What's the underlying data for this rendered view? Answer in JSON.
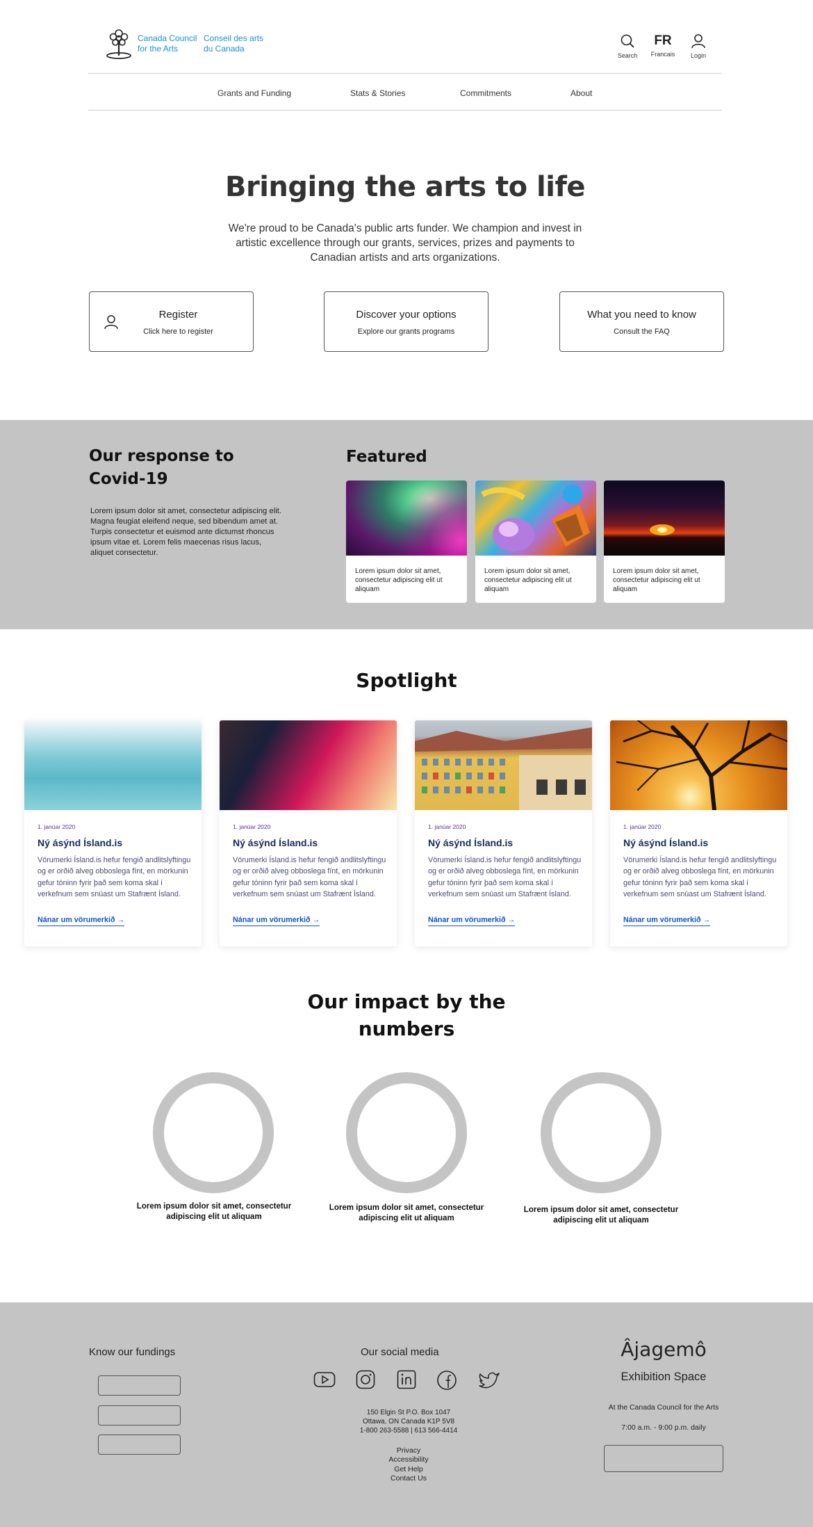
{
  "header": {
    "brand_en": "Canada Council\nfor the Arts",
    "brand_fr": "Conseil des arts\ndu Canada",
    "search_label": "Search",
    "lang_code": "FR",
    "lang_label": "Francais",
    "login_label": "Login"
  },
  "nav": {
    "items": [
      {
        "label": "Grants and Funding"
      },
      {
        "label": "Stats & Stories"
      },
      {
        "label": "Commitments"
      },
      {
        "label": "About"
      }
    ]
  },
  "hero": {
    "title": "Bringing the arts to life",
    "text": "We're proud to be Canada's public arts funder. We champion and invest in artistic excellence through our grants, services, prizes and payments to Canadian artists and arts organizations.",
    "ctas": [
      {
        "title": "Register",
        "subtitle": "Click here to register",
        "icon": "user-icon"
      },
      {
        "title": "Discover your options",
        "subtitle": "Explore our grants programs"
      },
      {
        "title": "What you need to know",
        "subtitle": "Consult the FAQ"
      }
    ]
  },
  "covid": {
    "title": "Our response to Covid-19",
    "text": "Lorem ipsum dolor sit amet, consectetur adipiscing elit. Magna feugiat eleifend neque, sed bibendum amet at. Turpis consectetur et euismod ante dictumst rhoncus ipsum vitae et. Lorem felis maecenas risus lacus, aliquet consectetur."
  },
  "featured": {
    "title": "Featured",
    "cards": [
      {
        "text": "Lorem ipsum dolor sit amet, consectetur adipiscing elit ut aliquam"
      },
      {
        "text": "Lorem ipsum dolor sit amet, consectetur adipiscing elit ut aliquam"
      },
      {
        "text": "Lorem ipsum dolor sit amet, consectetur adipiscing elit ut aliquam"
      }
    ]
  },
  "spotlight": {
    "title": "Spotlight",
    "cards": [
      {
        "date": "1. janúar 2020",
        "title": "Ný ásýnd Ísland.is",
        "body": "Vörumerki Ísland.is hefur fengið andlitslyftingu og er orðið alveg obboslega fínt, en mörkunin gefur tóninn fyrir það sem koma skal í verkefnum sem snúast um Stafrænt Ísland.",
        "link": "Nánar um vörumerkið"
      },
      {
        "date": "1. janúar 2020",
        "title": "Ný ásýnd Ísland.is",
        "body": "Vörumerki Ísland.is hefur fengið andlitslyftingu og er orðið alveg obboslega fínt, en mörkunin gefur tóninn fyrir það sem koma skal í verkefnum sem snúast um Stafrænt Ísland.",
        "link": "Nánar um vörumerkið"
      },
      {
        "date": "1. janúar 2020",
        "title": "Ný ásýnd Ísland.is",
        "body": "Vörumerki Ísland.is hefur fengið andlitslyftingu og er orðið alveg obboslega fínt, en mörkunin gefur tóninn fyrir það sem koma skal í verkefnum sem snúast um Stafrænt Ísland.",
        "link": "Nánar um vörumerkið"
      },
      {
        "date": "1. janúar 2020",
        "title": "Ný ásýnd Ísland.is",
        "body": "Vörumerki Ísland.is hefur fengið andlitslyftingu og er orðið alveg obboslega fínt, en mörkunin gefur tóninn fyrir það sem koma skal í verkefnum sem snúast um Stafrænt Ísland.",
        "link": "Nánar um vörumerkið"
      }
    ]
  },
  "impact": {
    "title": "Our impact by the numbers",
    "items": [
      {
        "caption": "Lorem ipsum dolor sit amet, consectetur adipiscing elit ut aliquam"
      },
      {
        "caption": "Lorem ipsum dolor sit amet, consectetur adipiscing elit ut aliquam"
      },
      {
        "caption": "Lorem ipsum dolor sit amet, consectetur adipiscing elit ut aliquam"
      }
    ]
  },
  "footer": {
    "fundings_title": "Know our fundings",
    "social_title": "Our social media",
    "social_icons": [
      "youtube-icon",
      "instagram-icon",
      "linkedin-icon",
      "facebook-icon",
      "twitter-icon"
    ],
    "address": [
      "150 Elgin St P.O. Box 1047",
      "Ottawa, ON Canada K1P 5V8",
      "1-800 263-5588 | 613 566-4414"
    ],
    "links": [
      "Privacy",
      "Accessibility",
      "Get Help",
      "Contact Us"
    ],
    "ajagemo_title": "Âjagemô",
    "ajagemo_sub": "Exhibition Space",
    "ajagemo_place": "At the Canada Council for the Arts",
    "ajagemo_hours": "7:00 a.m. - 9:00 p.m. daily"
  },
  "colors": {
    "brand": "#1a8fd1",
    "band": "#c4c4c4",
    "link": "#1155cc",
    "date": "#5b2d91"
  }
}
